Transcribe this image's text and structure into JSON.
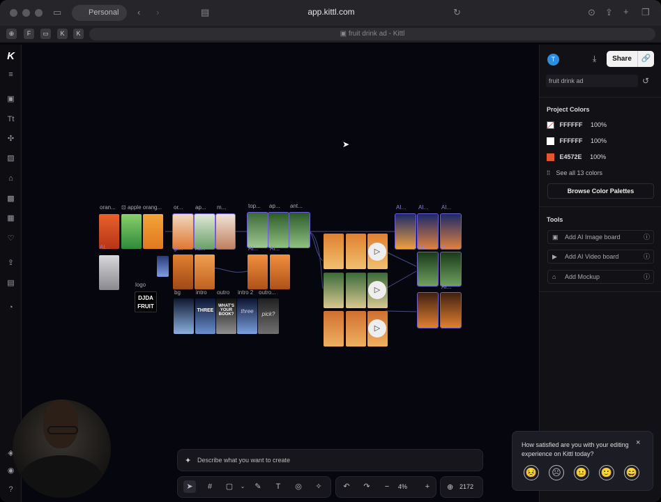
{
  "browser": {
    "profile": "Personal",
    "url": "app.kittl.com",
    "tab_title": "fruit drink ad - Kittl"
  },
  "canvas": {
    "labels": [
      "oran...",
      "apple",
      "orang...",
      "or...",
      "ap...",
      "m...",
      "top...",
      "ap...",
      "ant...",
      "AI...",
      "AI...",
      "AI...",
      "AI...",
      "AI...",
      "gr...",
      "AI...",
      "AI...",
      "AI...",
      "AI...",
      "AI...",
      "logo",
      "bg",
      "intro",
      "outro",
      "intro 2",
      "outro..."
    ],
    "logo_text": "DJDA FRUIT",
    "bg_card_texts": [
      "THREE",
      "WHAT'S YOUR BOOK?",
      "three",
      "pick?"
    ]
  },
  "right_panel": {
    "avatar": "T",
    "share_label": "Share",
    "project_name": "fruit drink ad",
    "colors_title": "Project Colors",
    "colors": [
      {
        "hex": "FFFFFF",
        "opacity": "100%",
        "swatch": "#ffffff"
      },
      {
        "hex": "FFFFFF",
        "opacity": "100%",
        "swatch": "#ffffff"
      },
      {
        "hex": "E4572E",
        "opacity": "100%",
        "swatch": "#E4572E"
      }
    ],
    "see_all": "See all 13 colors",
    "browse": "Browse Color Palettes",
    "tools_title": "Tools",
    "tools": [
      "Add AI Image board",
      "Add AI Video board",
      "Add Mockup"
    ]
  },
  "bottom": {
    "prompt_placeholder": "Describe what you want to create",
    "zoom": "4%",
    "credits": "2172"
  },
  "survey": {
    "question": "How satisfied are you with your editing experience on Kittl today?",
    "faces": [
      "😣",
      "☹",
      "😐",
      "🙂",
      "😄"
    ]
  }
}
